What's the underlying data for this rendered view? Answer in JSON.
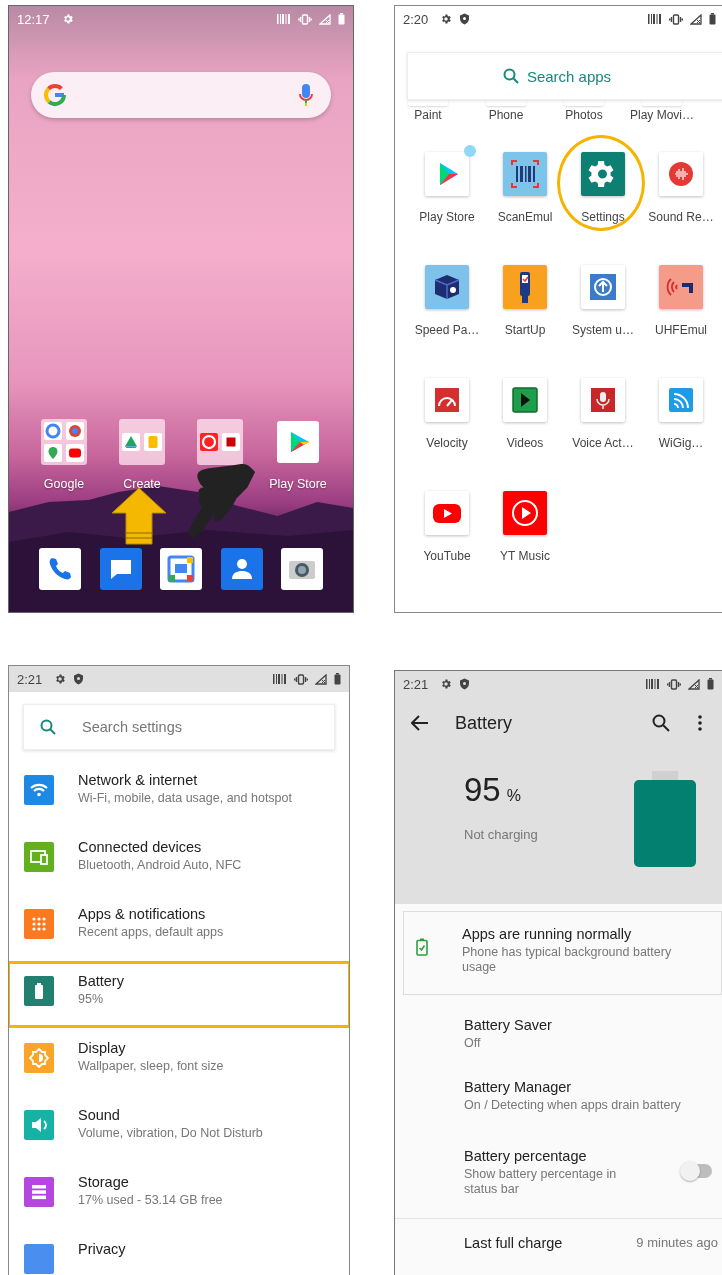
{
  "home": {
    "status": {
      "time": "12:17"
    },
    "apps": [
      {
        "kind": "folder",
        "label": "Google"
      },
      {
        "kind": "folder",
        "label": "Create"
      },
      {
        "kind": "folder"
      },
      {
        "kind": "app",
        "label": "Play Store"
      }
    ]
  },
  "drawer": {
    "status": {
      "time": "2:20"
    },
    "search": {
      "placeholder": "Search apps"
    },
    "apps": [
      {
        "kind": "cut",
        "label": "Paint",
        "highlighted": false
      },
      {
        "kind": "cut",
        "label": "Phone",
        "highlighted": false
      },
      {
        "kind": "cut",
        "label": "Photos",
        "highlighted": false
      },
      {
        "kind": "cut",
        "label": "Play Movi…",
        "highlighted": false
      },
      {
        "kind": "app",
        "label": "Play Store",
        "highlighted": false,
        "dot": true
      },
      {
        "kind": "app",
        "label": "ScanEmul",
        "highlighted": false,
        "dot": false
      },
      {
        "kind": "app",
        "label": "Settings",
        "highlighted": true,
        "dot": false
      },
      {
        "kind": "app",
        "label": "Sound Re…",
        "highlighted": false,
        "dot": false
      },
      {
        "kind": "app",
        "label": "Speed Pa…",
        "highlighted": false,
        "dot": false
      },
      {
        "kind": "app",
        "label": "StartUp",
        "highlighted": false,
        "dot": false
      },
      {
        "kind": "app",
        "label": "System u…",
        "highlighted": false,
        "dot": false
      },
      {
        "kind": "app",
        "label": "UHFEmul",
        "highlighted": false,
        "dot": false
      },
      {
        "kind": "app",
        "label": "Velocity",
        "highlighted": false,
        "dot": false
      },
      {
        "kind": "app",
        "label": "Videos",
        "highlighted": false,
        "dot": false
      },
      {
        "kind": "app",
        "label": "Voice Act…",
        "highlighted": false,
        "dot": false
      },
      {
        "kind": "app",
        "label": "WiGig…",
        "highlighted": false,
        "dot": false
      },
      {
        "kind": "app",
        "label": "YouTube",
        "highlighted": false,
        "dot": false
      },
      {
        "kind": "app",
        "label": "YT Music",
        "highlighted": false,
        "dot": false
      }
    ]
  },
  "settings": {
    "status": {
      "time": "2:21"
    },
    "search": {
      "placeholder": "Search settings"
    },
    "items": [
      {
        "title": "Network & internet",
        "summary": "Wi-Fi, mobile, data usage, and hotspot",
        "color": "#1e88e5",
        "highlighted": false
      },
      {
        "title": "Connected devices",
        "summary": "Bluetooth, Android Auto, NFC",
        "color": "#62b01e",
        "highlighted": false
      },
      {
        "title": "Apps & notifications",
        "summary": "Recent apps, default apps",
        "color": "#fb7a1f",
        "highlighted": false
      },
      {
        "title": "Battery",
        "summary": "95%",
        "color": "#21806f",
        "highlighted": true
      },
      {
        "title": "Display",
        "summary": "Wallpaper, sleep, font size",
        "color": "#fba42a",
        "highlighted": false
      },
      {
        "title": "Sound",
        "summary": "Volume, vibration, Do Not Disturb",
        "color": "#17b2a6",
        "highlighted": false
      },
      {
        "title": "Storage",
        "summary": "17% used - 53.14 GB free",
        "color": "#b546e0",
        "highlighted": false
      },
      {
        "title": "Privacy",
        "color": "#4a8ef0",
        "highlighted": false
      }
    ]
  },
  "battery": {
    "status": {
      "time": "2:21"
    },
    "title": "Battery",
    "percent": "95",
    "unit": "%",
    "level": 0.95,
    "charge_state": "Not charging",
    "tip": {
      "title": "Apps are running normally",
      "summary": "Phone has typical background battery usage"
    },
    "items": [
      {
        "kind": "text",
        "title": "Battery Saver",
        "summary": "Off"
      },
      {
        "kind": "text",
        "title": "Battery Manager",
        "summary": "On / Detecting when apps drain battery"
      },
      {
        "kind": "toggle",
        "title": "Battery percentage",
        "summary": "Show battery percentage in status bar",
        "on": false
      },
      {
        "kind": "value",
        "title": "Last full charge",
        "value": "9 minutes ago"
      }
    ]
  }
}
